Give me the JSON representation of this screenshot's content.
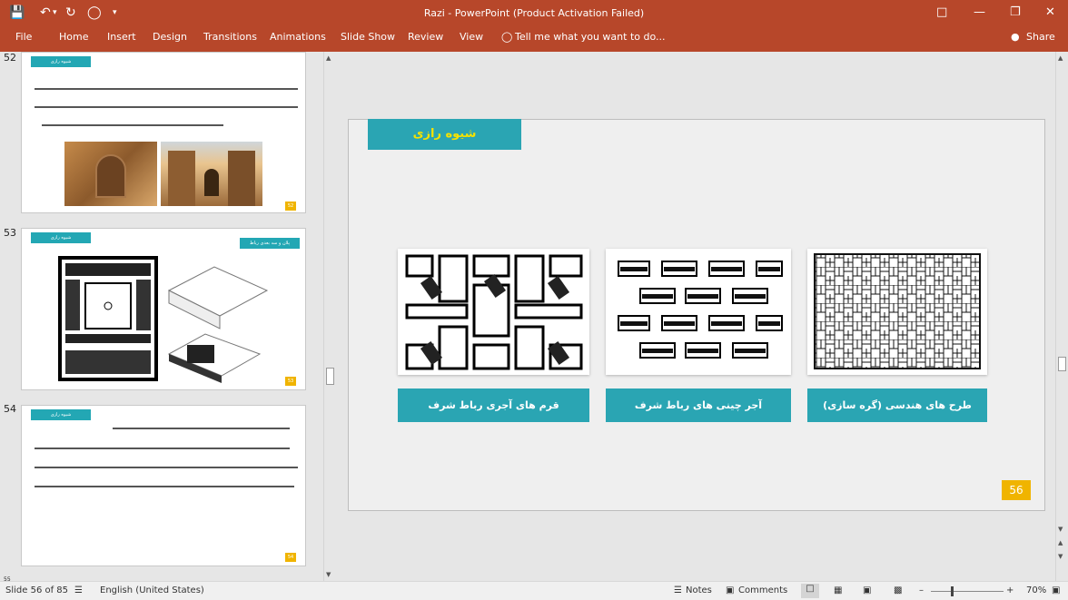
{
  "window": {
    "title": "Razi - PowerPoint (Product Activation Failed)"
  },
  "ribbon": {
    "tabs": [
      "File",
      "Home",
      "Insert",
      "Design",
      "Transitions",
      "Animations",
      "Slide Show",
      "Review",
      "View"
    ],
    "tell_me": "Tell me what you want to do...",
    "share": "Share"
  },
  "thumbnails": [
    {
      "number": "52",
      "header": "شیوه رازی",
      "page": "52"
    },
    {
      "number": "53",
      "header": "شیوه رازی",
      "subheader": "پلان و سه بعدی رباط",
      "page": "53"
    },
    {
      "number": "54",
      "header": "شیوه رازی",
      "page": "54"
    }
  ],
  "slide": {
    "title": "شیوه رازی",
    "captions": [
      "قرم های آجری رباط شرف",
      "آجر چینی های رباط شرف",
      "طرح های هندسی (گره سازی)"
    ],
    "page_number": "56"
  },
  "status": {
    "slide_info": "Slide 56 of 85",
    "language": "English (United States)",
    "notes": "Notes",
    "comments": "Comments",
    "zoom": "70%"
  },
  "colors": {
    "accent": "#b7472a",
    "teal": "#2aa5b3",
    "page_badge": "#f0b400"
  }
}
